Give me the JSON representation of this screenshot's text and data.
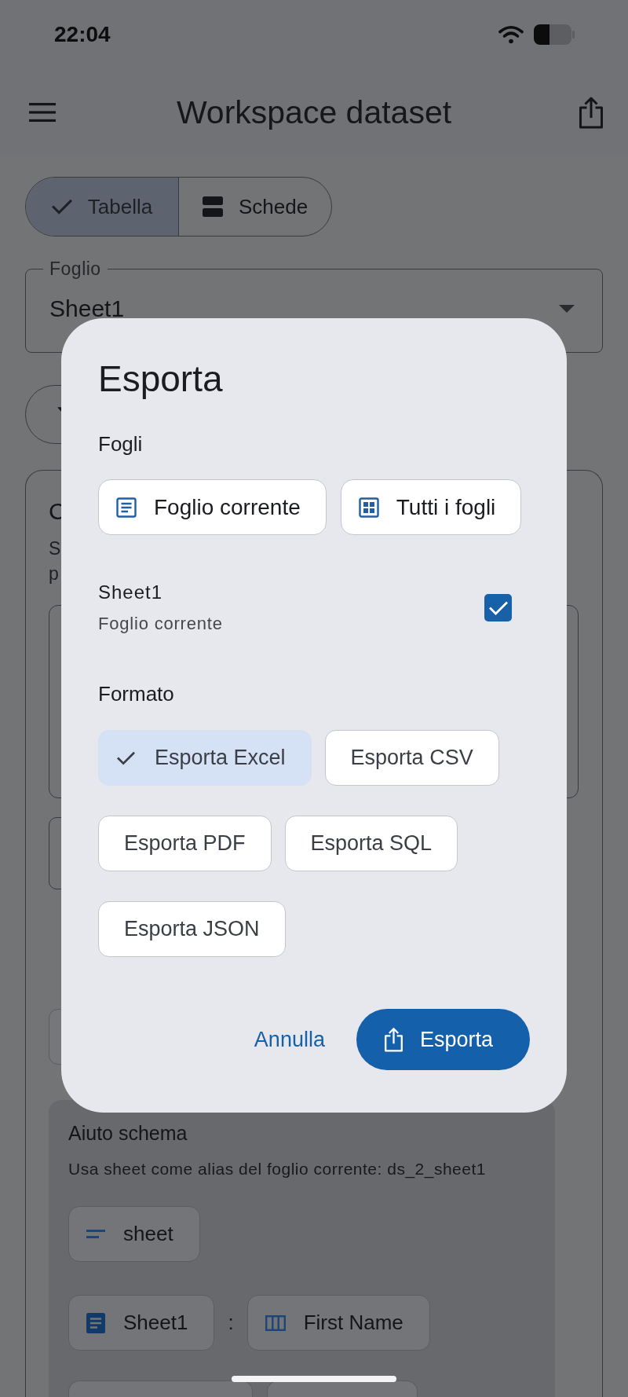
{
  "status_bar": {
    "time": "22:04"
  },
  "app_bar": {
    "title": "Workspace dataset"
  },
  "view_toggle": [
    {
      "label": "Tabella",
      "selected": true
    },
    {
      "label": "Schede",
      "kind": "cards",
      "selected": false
    }
  ],
  "sheet_select": {
    "label": "Foglio",
    "value": "Sheet1"
  },
  "query_card": {
    "title": "C",
    "lines": [
      "S",
      "p"
    ]
  },
  "schema_help": {
    "title": "Aiuto schema",
    "text": "Usa sheet come alias del foglio corrente: ds_2_sheet1",
    "alias_chip": "sheet",
    "mappings": [
      {
        "sheet": "Sheet1",
        "separator": ":",
        "column": "First Name"
      }
    ]
  },
  "export_dialog": {
    "title": "Esporta",
    "sheets_heading": "Fogli",
    "sheet_buttons": [
      {
        "label": "Foglio corrente",
        "kind": "current"
      },
      {
        "label": "Tutti i fogli",
        "kind": "all"
      }
    ],
    "sheets": [
      {
        "name": "Sheet1",
        "subtitle": "Foglio corrente",
        "checked": true
      }
    ],
    "format_heading": "Formato",
    "formats": [
      {
        "label": "Esporta Excel",
        "selected": true
      },
      {
        "label": "Esporta CSV",
        "selected": false
      },
      {
        "label": "Esporta PDF",
        "selected": false
      },
      {
        "label": "Esporta SQL",
        "selected": false
      },
      {
        "label": "Esporta JSON",
        "selected": false
      }
    ],
    "actions": [
      {
        "label": "Annulla",
        "kind": "text"
      },
      {
        "label": "Esporta",
        "kind": "filled"
      }
    ]
  }
}
